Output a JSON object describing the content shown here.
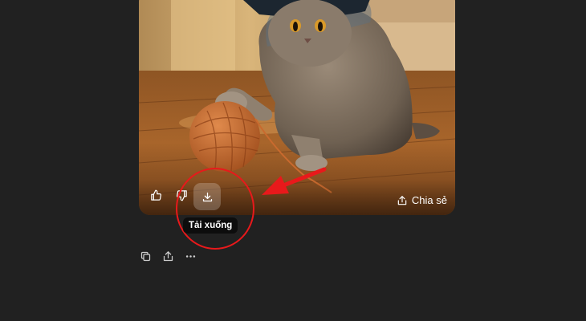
{
  "image_overlay": {
    "like_icon": "thumbs-up-icon",
    "dislike_icon": "thumbs-down-icon",
    "download_icon": "download-icon",
    "share_icon": "share-icon",
    "share_label": "Chia sẻ"
  },
  "tooltip": {
    "text": "Tải xuống"
  },
  "message_actions": {
    "copy_icon": "copy-icon",
    "share_icon": "share-icon",
    "more_icon": "more-horizontal-icon"
  },
  "annotation": {
    "accent": "#e8191b"
  }
}
